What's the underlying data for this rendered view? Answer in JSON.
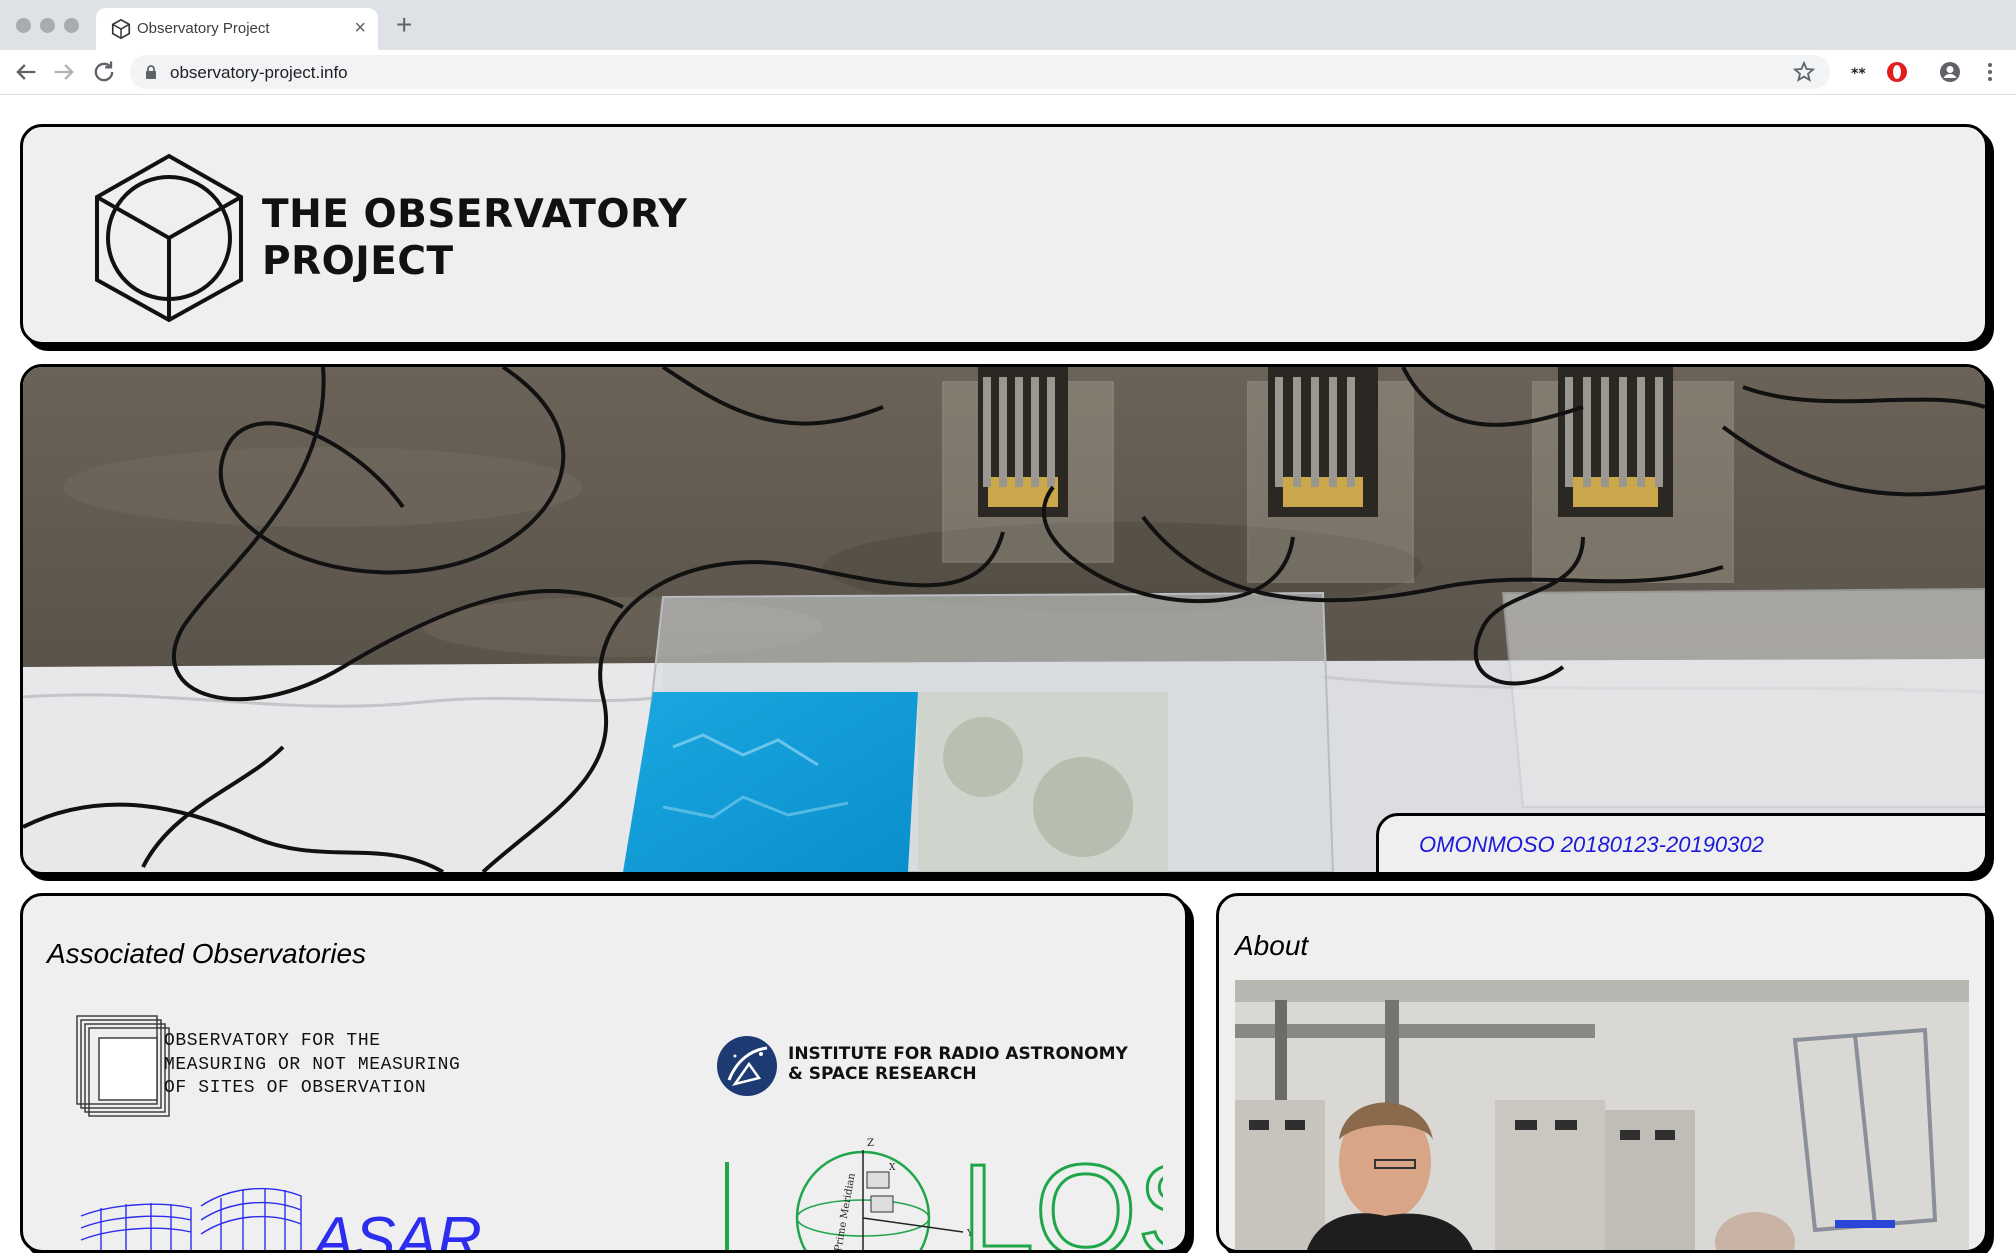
{
  "browser": {
    "tab_title": "Observatory Project",
    "tab_close": "×",
    "new_tab": "+",
    "url": "observatory-project.info"
  },
  "header": {
    "logo_line1": "THE OBSERVATORY",
    "logo_line2": "PROJECT"
  },
  "hero": {
    "caption": "OMONMOSO 20180123-20190302"
  },
  "associated": {
    "title": "Associated Observatories",
    "omo_line1": "OBSERVATORY FOR THE",
    "omo_line2": "MEASURING OR NOT MEASURING",
    "omo_line3": "OF SITES OF OBSERVATION",
    "irasr_line1": "INSTITUTE FOR RADIO ASTRONOMY",
    "irasr_line2": "& SPACE RESEARCH",
    "asar_text": "ASAR",
    "lost_text": "LOST",
    "lost_label_z": "Z",
    "lost_label_meridian": "Prime Meridian",
    "lost_label_x": "X",
    "lost_label_y": "Y"
  },
  "about": {
    "title": "About"
  },
  "colors": {
    "link": "#1a1adb",
    "panel_bg": "#efefef",
    "lost_green": "#1fa64a"
  },
  "icons": [
    "cube-icon",
    "back-icon",
    "forward-icon",
    "reload-icon",
    "lock-icon",
    "star-icon",
    "extension-icon",
    "opera-icon",
    "account-icon",
    "menu-icon"
  ]
}
